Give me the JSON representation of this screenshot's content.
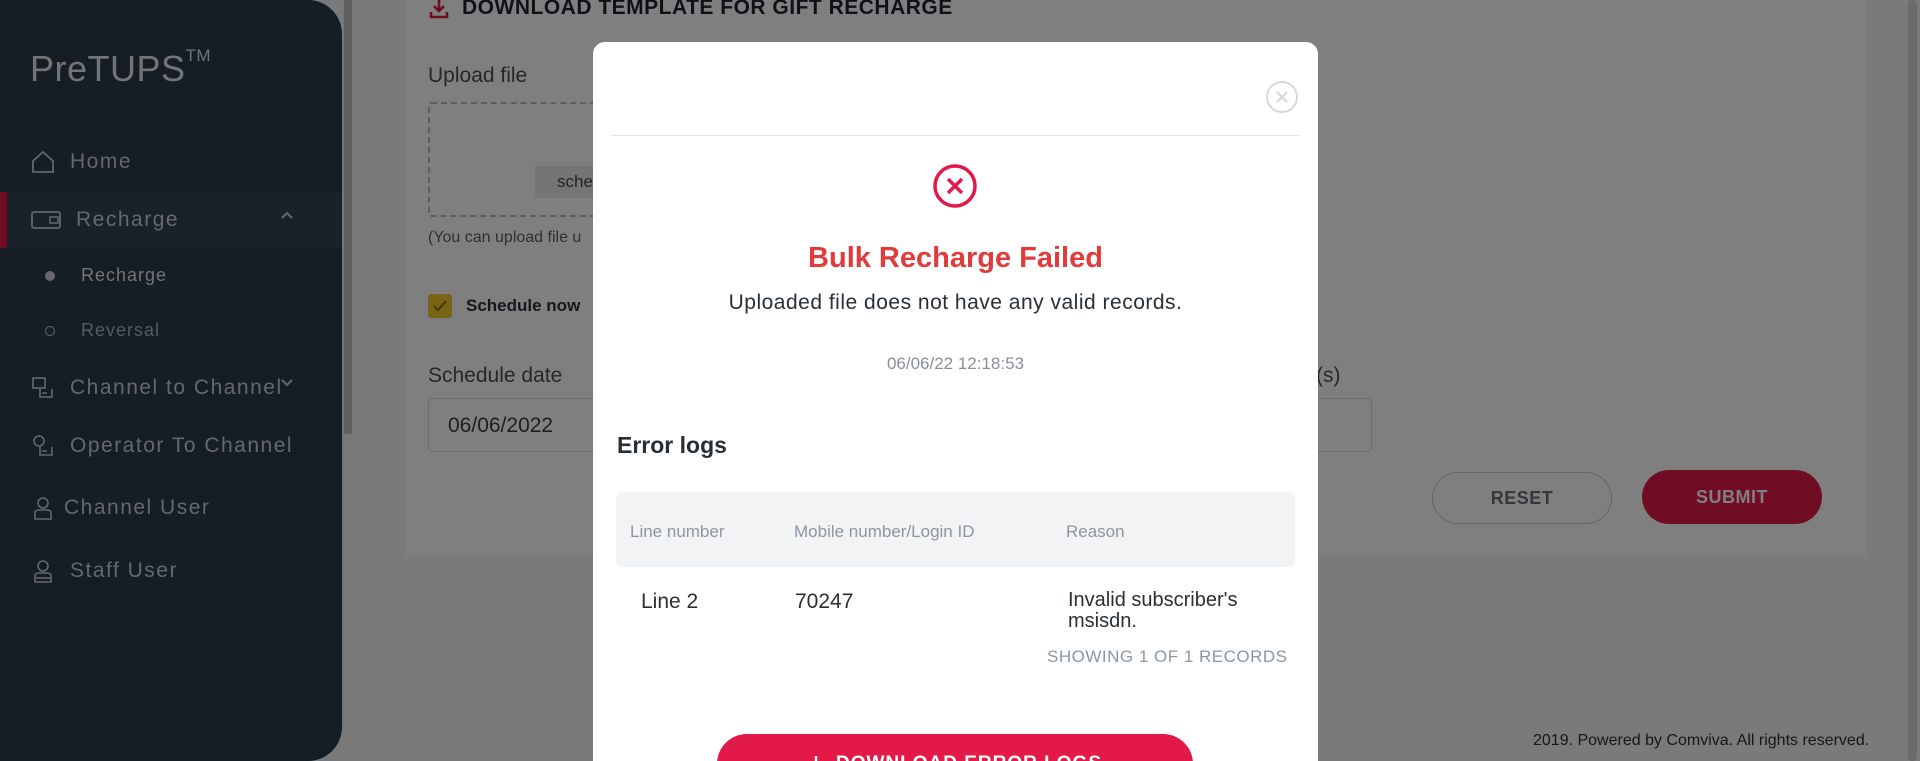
{
  "app": {
    "logo": "PreTUPS",
    "logo_tm": "TM"
  },
  "sidebar": {
    "items": [
      {
        "label": "Home",
        "icon": "home-icon"
      },
      {
        "label": "Recharge",
        "icon": "recharge-card-icon",
        "active": true,
        "expanded": true
      },
      {
        "label": "Channel to Channel",
        "icon": "channel-transfer-icon"
      },
      {
        "label": "Operator To Channel",
        "icon": "operator-transfer-icon"
      },
      {
        "label": "Channel User",
        "icon": "user-icon"
      },
      {
        "label": "Staff User",
        "icon": "staff-user-icon"
      }
    ],
    "sub_items": [
      {
        "label": "Recharge",
        "selected": true
      },
      {
        "label": "Reversal",
        "selected": false
      }
    ]
  },
  "form": {
    "download_template": "DOWNLOAD TEMPLATE FOR GIFT RECHARGE",
    "upload_label": "Upload file",
    "choose_button_partial": "sche",
    "upload_hint_partial": "(You can upload file u",
    "schedule_now_label": "Schedule now",
    "schedule_now_checked": true,
    "schedule_date_label": "Schedule date",
    "schedule_date_value": "06/06/2022",
    "partial_label": "(s)",
    "reset_label": "RESET",
    "submit_label": "SUBMIT"
  },
  "footer": {
    "text": "2019. Powered by Comviva. All rights reserved."
  },
  "modal": {
    "status_icon": "error-circle-icon",
    "title": "Bulk Recharge Failed",
    "message": "Uploaded file does not have any valid records.",
    "timestamp": "06/06/22 12:18:53",
    "error_logs_title": "Error logs",
    "columns": [
      "Line number",
      "Mobile number/Login ID",
      "Reason"
    ],
    "rows": [
      {
        "line": "Line 2",
        "mobile": "70247",
        "reason": "Invalid subscriber's msisdn."
      }
    ],
    "records_info": "SHOWING 1 OF 1 RECORDS",
    "download_logs_label": "DOWNLOAD ERROR LOGS"
  },
  "colors": {
    "accent": "#e3194a",
    "error_title": "#e23b3b",
    "sidebar_bg": "#2b3a4a",
    "checkbox": "#f3c62a"
  }
}
